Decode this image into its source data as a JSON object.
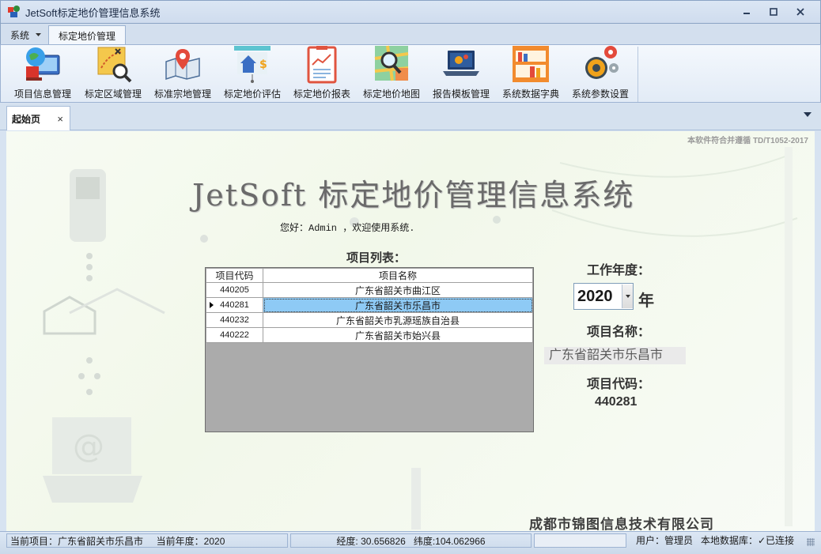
{
  "window": {
    "title": "JetSoft标定地价管理信息系统"
  },
  "menu": {
    "system_label": "系统",
    "active_tab": "标定地价管理"
  },
  "ribbon": {
    "buttons": [
      {
        "label": "项目信息管理",
        "icon": "globe-computer-icon"
      },
      {
        "label": "标定区域管理",
        "icon": "map-search-icon"
      },
      {
        "label": "标准宗地管理",
        "icon": "map-pin-icon"
      },
      {
        "label": "标定地价评估",
        "icon": "house-dollar-icon"
      },
      {
        "label": "标定地价报表",
        "icon": "clipboard-chart-icon"
      },
      {
        "label": "标定地价地图",
        "icon": "map-magnifier-icon"
      },
      {
        "label": "报告模板管理",
        "icon": "laptop-gear-icon"
      },
      {
        "label": "系统数据字典",
        "icon": "bookshelf-icon"
      },
      {
        "label": "系统参数设置",
        "icon": "gears-icon"
      }
    ]
  },
  "doc_tab": {
    "label": "起始页",
    "close": "×"
  },
  "home": {
    "standard_note": "本软件符合并遵循 TD/T1052-2017",
    "app_title": "JetSoft 标定地价管理信息系统",
    "greeting": "您好：Admin ，欢迎使用系统.",
    "list_title": "项目列表：",
    "table": {
      "headers": [
        "项目代码",
        "项目名称"
      ],
      "rows": [
        {
          "code": "440205",
          "name": "广东省韶关市曲江区"
        },
        {
          "code": "440281",
          "name": "广东省韶关市乐昌市"
        },
        {
          "code": "440232",
          "name": "广东省韶关市乳源瑶族自治县"
        },
        {
          "code": "440222",
          "name": "广东省韶关市始兴县"
        }
      ]
    },
    "work_year_label": "工作年度：",
    "work_year": "2020",
    "year_unit": "年",
    "project_name_label": "项目名称：",
    "project_name": "广东省韶关市乐昌市",
    "project_code_label": "项目代码：",
    "project_code": "440281",
    "company": "成都市锦图信息技术有限公司"
  },
  "status": {
    "current": "当前项目：广东省韶关市乐昌市     当前年度：2020",
    "coords": "经度: 30.656826   纬度:104.062966",
    "user": "用户：管理员   本地数据库：✓已连接"
  },
  "colors": {
    "selection": "#8ecaf5",
    "chrome": "#d7e3f1"
  }
}
